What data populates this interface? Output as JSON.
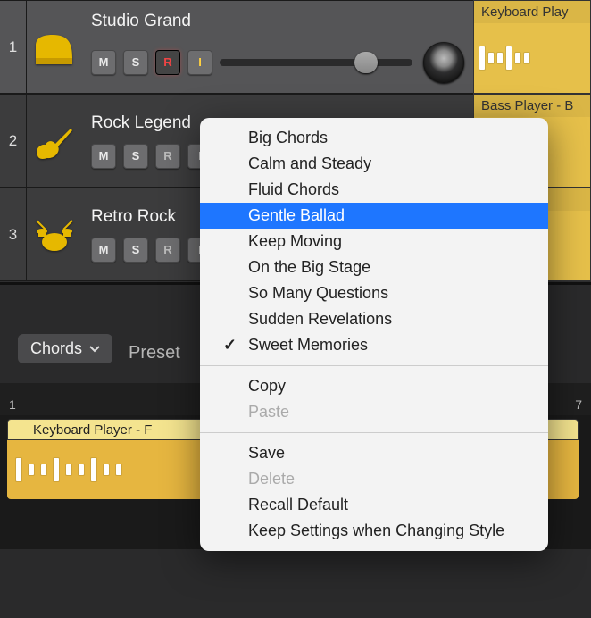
{
  "tracks": [
    {
      "num": "1",
      "name": "Studio Grand",
      "icon": "piano",
      "selected": true,
      "btns": {
        "m": "M",
        "s": "S",
        "r": "R",
        "i": "I"
      },
      "region_label": "Keyboard Play"
    },
    {
      "num": "2",
      "name": "Rock Legend",
      "icon": "guitar",
      "selected": false,
      "btns": {
        "m": "M",
        "s": "S",
        "r": "R",
        "i": "I"
      },
      "region_label": "Bass Player - B"
    },
    {
      "num": "3",
      "name": "Retro Rock",
      "icon": "drums",
      "selected": false,
      "btns": {
        "m": "M",
        "s": "S",
        "r": "R",
        "i": "I"
      },
      "region_label": "                - Po"
    }
  ],
  "lower_toolbar": {
    "dropdown_label": "Chords",
    "preset_label": "Preset"
  },
  "timeline": {
    "ruler_marks": [
      "1",
      "7"
    ],
    "region_label": "Keyboard Player - F"
  },
  "context_menu": {
    "groups": [
      [
        {
          "label": "Big Chords"
        },
        {
          "label": "Calm and Steady"
        },
        {
          "label": "Fluid Chords"
        },
        {
          "label": "Gentle Ballad",
          "highlight": true
        },
        {
          "label": "Keep Moving"
        },
        {
          "label": "On the Big Stage"
        },
        {
          "label": "So Many Questions"
        },
        {
          "label": "Sudden Revelations"
        },
        {
          "label": "Sweet Memories",
          "checked": true
        }
      ],
      [
        {
          "label": "Copy"
        },
        {
          "label": "Paste",
          "disabled": true
        }
      ],
      [
        {
          "label": "Save"
        },
        {
          "label": "Delete",
          "disabled": true
        },
        {
          "label": "Recall Default"
        },
        {
          "label": "Keep Settings when Changing Style"
        }
      ]
    ]
  }
}
